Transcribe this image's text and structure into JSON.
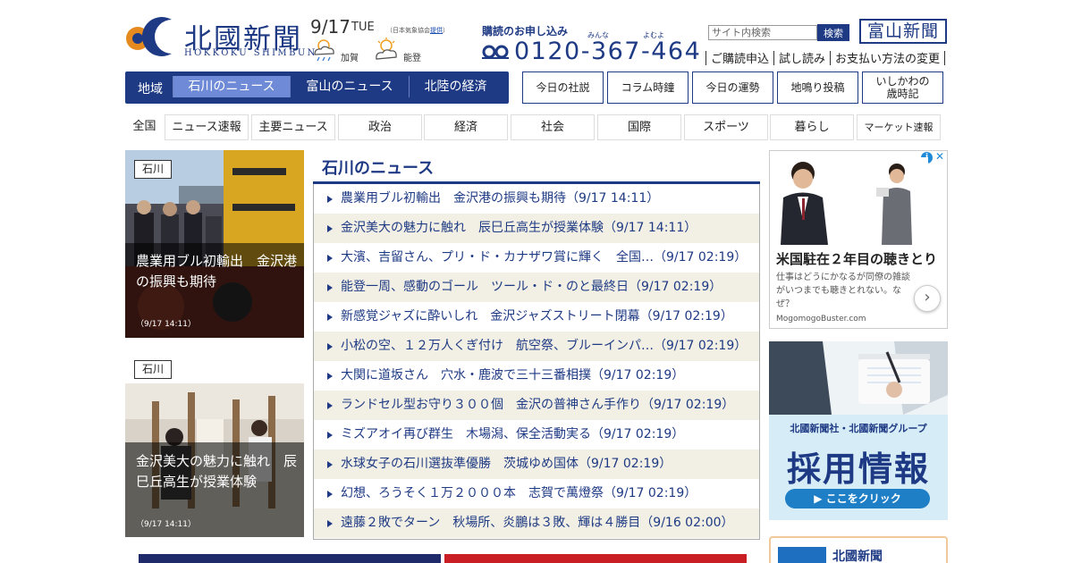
{
  "header": {
    "logo_title": "北國新聞",
    "logo_sub": "HOKKOKU SHIMBUN",
    "date": "9/17",
    "day_of_week": "TUE",
    "weather_note_prefix": "（日本気象協会",
    "weather_note_link": "提供",
    "weather_note_suffix": "）",
    "weather": [
      {
        "label": "加賀",
        "icon": "cloud-rain-icon"
      },
      {
        "label": "能登",
        "icon": "sun-cloud-icon"
      }
    ],
    "subscribe_title": "購読のお申し込み",
    "subscribe_ruby_1": "みんな",
    "subscribe_ruby_2": "よむよ",
    "phone": "0120-367-464",
    "search_placeholder": "サイト内検索",
    "search_button": "検索",
    "toyama_logo": "富山新聞",
    "top_links": [
      "ご購読申込",
      "試し読み",
      "お支払い方法の変更"
    ]
  },
  "region_nav": {
    "label": "地域",
    "tabs": [
      "石川のニュース",
      "富山のニュース",
      "北陸の経済"
    ]
  },
  "feature_buttons": [
    "今日の社説",
    "コラム時鐘",
    "今日の運勢",
    "地鳴り投稿",
    "いしかわの\n歳時記"
  ],
  "category_nav": {
    "all": "全国",
    "items": [
      "ニュース速報",
      "主要ニュース",
      "政治",
      "経済",
      "社会",
      "国際",
      "スポーツ",
      "暮らし",
      "マーケット速報"
    ]
  },
  "features": [
    {
      "tag": "石川",
      "title": "農業用ブル初輸出　金沢港の振興も期待",
      "time": "（9/17 14:11）"
    },
    {
      "tag": "石川",
      "title": "金沢美大の魅力に触れ　辰巳丘高生が授業体験",
      "time": "（9/17 14:11）"
    }
  ],
  "news": {
    "heading": "石川のニュース",
    "items": [
      "農業用ブル初輸出　金沢港の振興も期待（9/17 14:11）",
      "金沢美大の魅力に触れ　辰巳丘高生が授業体験（9/17 14:11）",
      "大濱、吉留さん、プリ・ド・カナザワ賞に輝く　全国…（9/17 02:19）",
      "能登一周、感動のゴール　ツール・ド・のと最終日（9/17 02:19）",
      "新感覚ジャズに酔いしれ　金沢ジャズストリート閉幕（9/17 02:19）",
      "小松の空、１２万人くぎ付け　航空祭、ブルーインパ…（9/17 02:19）",
      "大関に道坂さん　穴水・鹿波で三十三番相撲（9/17 02:19）",
      "ランドセル型お守り３００個　金沢の普神さん手作り（9/17 02:19）",
      "ミズアオイ再び群生　木場潟、保全活動実る（9/17 02:19）",
      "水球女子の石川選抜準優勝　茨城ゆめ国体（9/17 02:19）",
      "幻想、ろうそく１万２０００本　志賀で萬燈祭（9/17 02:19）",
      "遠藤２敗でターン　秋場所、炎鵬は３敗、輝は４勝目（9/16 02:00）"
    ]
  },
  "ads": {
    "ad1": {
      "badge": "i",
      "close": "✕",
      "title": "米国駐在２年目の聴きとり",
      "body": "仕事はどうにかなるが同僚の雑談がいつまでも聴きとれない。なぜ？",
      "source": "MogomogoBuster.com",
      "arrow": "›"
    },
    "ad2": {
      "sub": "北國新聞社・北國新聞グループ",
      "main": "採用情報",
      "button": "▶ ここをクリック"
    },
    "ad3": {
      "text": "北國新聞"
    }
  },
  "colors": {
    "brand": "#1e3a84",
    "region_active": "#6f8ad6",
    "news_alt_row": "#f2f0e4",
    "ad_blue": "#1e7fc7"
  }
}
